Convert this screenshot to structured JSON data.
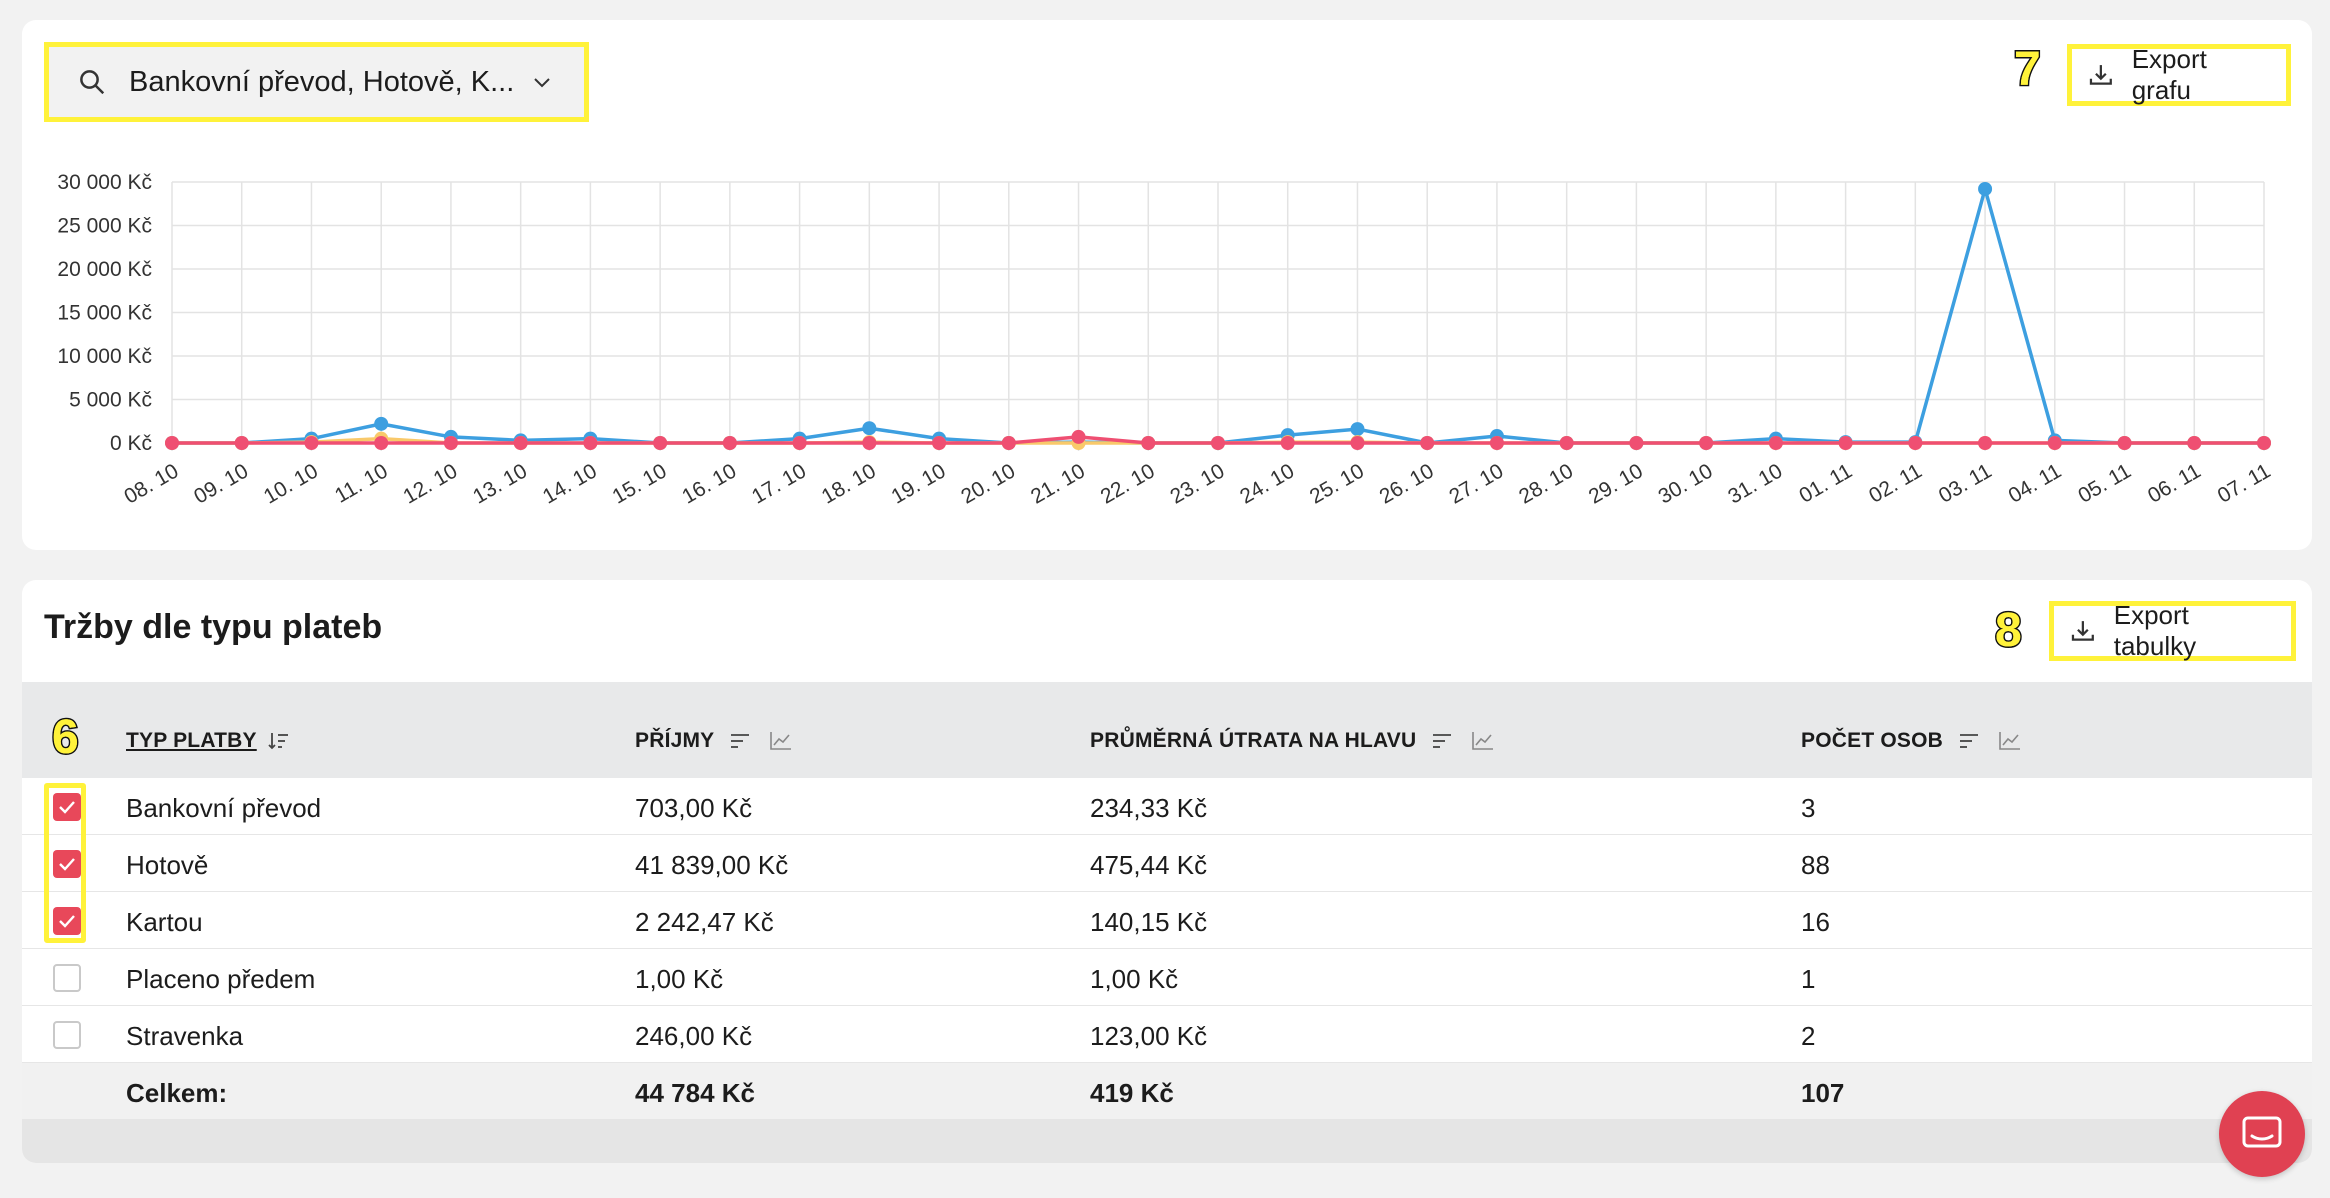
{
  "filter": {
    "text": "Bankovní převod, Hotově, K...",
    "search_icon": "search-icon",
    "chevron_icon": "chevron-down-icon"
  },
  "markers": {
    "six": "6",
    "seven": "7",
    "eight": "8"
  },
  "chart_export": {
    "label": "Export grafu",
    "icon": "download-icon"
  },
  "table_export": {
    "label": "Export tabulky",
    "icon": "download-icon"
  },
  "chart_data": {
    "type": "line",
    "x": [
      "08. 10",
      "09. 10",
      "10. 10",
      "11. 10",
      "12. 10",
      "13. 10",
      "14. 10",
      "15. 10",
      "16. 10",
      "17. 10",
      "18. 10",
      "19. 10",
      "20. 10",
      "21. 10",
      "22. 10",
      "23. 10",
      "24. 10",
      "25. 10",
      "26. 10",
      "27. 10",
      "28. 10",
      "29. 10",
      "30. 10",
      "31. 10",
      "01. 11",
      "02. 11",
      "03. 11",
      "04. 11",
      "05. 11",
      "06. 11",
      "07. 11"
    ],
    "y_ticks": [
      "30 000 Kč",
      "25 000 Kč",
      "20 000 Kč",
      "15 000 Kč",
      "10 000 Kč",
      "5 000 Kč",
      "0 Kč"
    ],
    "ylim": [
      0,
      30000
    ],
    "grid": true,
    "colors": {
      "blue": "#3d9fe0",
      "yellow": "#f9c96a",
      "pink": "#ef4f72"
    },
    "series": [
      {
        "color": "#3d9fe0",
        "values": [
          0,
          0,
          500,
          2200,
          700,
          300,
          500,
          0,
          0,
          500,
          1700,
          500,
          0,
          100,
          0,
          0,
          900,
          1600,
          0,
          800,
          0,
          0,
          0,
          500,
          100,
          100,
          29200,
          300,
          0,
          0,
          0
        ]
      },
      {
        "color": "#f9c96a",
        "values": [
          0,
          0,
          100,
          500,
          0,
          0,
          0,
          0,
          0,
          0,
          100,
          0,
          0,
          0,
          0,
          0,
          100,
          100,
          0,
          0,
          0,
          0,
          0,
          0,
          0,
          0,
          0,
          0,
          0,
          0,
          0
        ]
      },
      {
        "color": "#ef4f72",
        "values": [
          0,
          0,
          0,
          0,
          0,
          0,
          0,
          0,
          0,
          0,
          0,
          0,
          0,
          700,
          0,
          0,
          0,
          0,
          0,
          0,
          0,
          0,
          0,
          0,
          0,
          0,
          0,
          0,
          0,
          0,
          0
        ]
      }
    ]
  },
  "table": {
    "title": "Tržby dle typu plateb",
    "headers": {
      "type": "TYP PLATBY",
      "income": "PŘÍJMY",
      "avg": "PRŮMĚRNÁ ÚTRATA NA HLAVU",
      "count": "POČET OSOB"
    },
    "rows": [
      {
        "checked": true,
        "type": "Bankovní převod",
        "income": "703,00 Kč",
        "avg": "234,33 Kč",
        "count": "3"
      },
      {
        "checked": true,
        "type": "Hotově",
        "income": "41 839,00 Kč",
        "avg": "475,44 Kč",
        "count": "88"
      },
      {
        "checked": true,
        "type": "Kartou",
        "income": "2 242,47 Kč",
        "avg": "140,15 Kč",
        "count": "16"
      },
      {
        "checked": false,
        "type": "Placeno předem",
        "income": "1,00 Kč",
        "avg": "1,00 Kč",
        "count": "1"
      },
      {
        "checked": false,
        "type": "Stravenka",
        "income": "246,00 Kč",
        "avg": "123,00 Kč",
        "count": "2"
      }
    ],
    "total": {
      "label": "Celkem:",
      "income": "44 784 Kč",
      "avg": "419 Kč",
      "count": "107"
    }
  },
  "chat": {
    "icon": "chat-icon"
  }
}
